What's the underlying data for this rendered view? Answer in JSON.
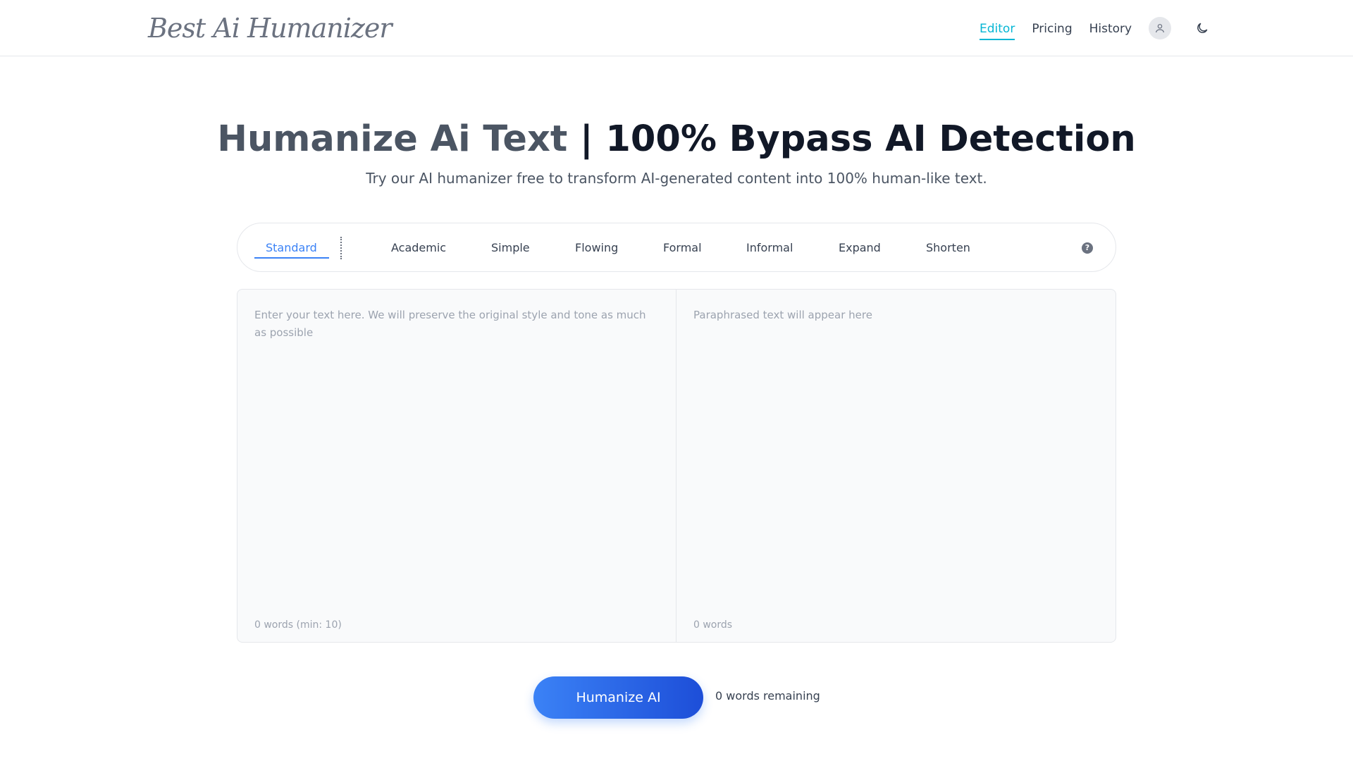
{
  "header": {
    "logo_text": "Best Ai Humanizer",
    "nav": [
      {
        "label": "Editor",
        "active": true
      },
      {
        "label": "Pricing",
        "active": false
      },
      {
        "label": "History",
        "active": false
      }
    ],
    "icons": {
      "user": "user-icon",
      "theme": "moon-icon"
    },
    "accent": "#06b6d4"
  },
  "hero": {
    "title_part1": "Humanize Ai Text",
    "title_part2": " | 100% Bypass AI Detection",
    "subtitle": "Try our AI humanizer free to transform AI-generated content into 100% human-like text."
  },
  "modes": {
    "items": [
      "Standard",
      "Academic",
      "Simple",
      "Flowing",
      "Formal",
      "Informal",
      "Expand",
      "Shorten"
    ],
    "active": "Standard",
    "help_icon": "question-circle-icon",
    "accent": "#3b82f6"
  },
  "editor": {
    "input_placeholder": "Enter your text here. We will preserve the original style and tone as much as possible",
    "input_value": "",
    "input_wordcount": "0 words (min: 10)",
    "output_placeholder": "Paraphrased text will appear here",
    "output_wordcount": "0 words"
  },
  "action": {
    "button_label": "Humanize AI",
    "remaining_text": "0 words remaining",
    "button_color": "#2563eb"
  }
}
